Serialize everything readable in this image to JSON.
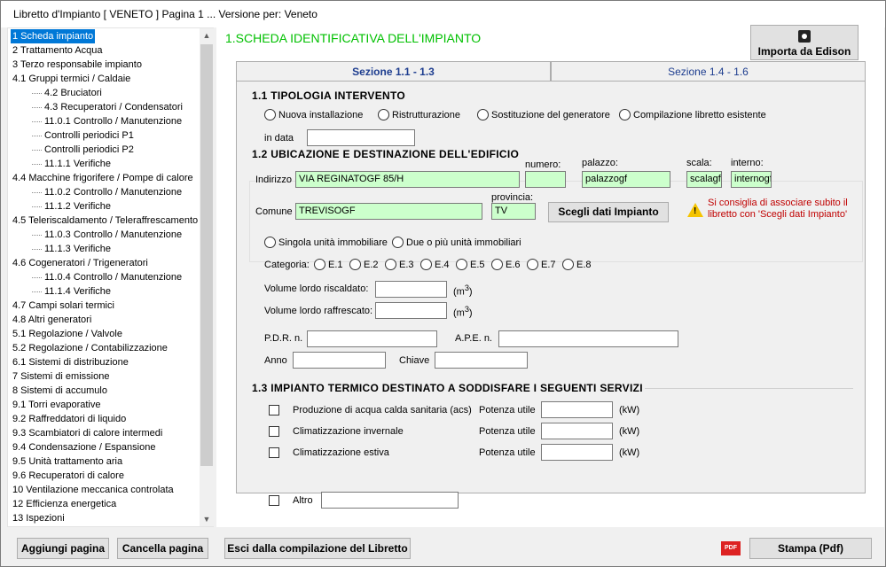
{
  "titlebar": {
    "text": "Libretto d'Impianto  [  VENETO  ]  Pagina 1 ... Versione per: Veneto"
  },
  "sidebar": {
    "items": [
      {
        "label": "1  Scheda impianto",
        "indent": 0,
        "selected": true
      },
      {
        "label": "2  Trattamento Acqua",
        "indent": 0
      },
      {
        "label": "3  Terzo responsabile impianto",
        "indent": 0
      },
      {
        "label": "4.1  Gruppi termici / Caldaie",
        "indent": 0
      },
      {
        "label": "4.2  Bruciatori",
        "indent": 2
      },
      {
        "label": "4.3  Recuperatori / Condensatori",
        "indent": 2
      },
      {
        "label": "11.0.1  Controllo / Manutenzione",
        "indent": 2
      },
      {
        "label": "Controlli periodici P1",
        "indent": 2
      },
      {
        "label": "Controlli periodici P2",
        "indent": 2
      },
      {
        "label": "11.1.1  Verifiche",
        "indent": 2
      },
      {
        "label": "4.4  Macchine frigorifere / Pompe di calore",
        "indent": 0
      },
      {
        "label": "11.0.2  Controllo / Manutenzione",
        "indent": 2
      },
      {
        "label": "11.1.2  Verifiche",
        "indent": 2
      },
      {
        "label": "4.5  Teleriscaldamento / Teleraffrescamento",
        "indent": 0
      },
      {
        "label": "11.0.3  Controllo / Manutenzione",
        "indent": 2
      },
      {
        "label": "11.1.3  Verifiche",
        "indent": 2
      },
      {
        "label": "4.6  Cogeneratori / Trigeneratori",
        "indent": 0
      },
      {
        "label": "11.0.4  Controllo / Manutenzione",
        "indent": 2
      },
      {
        "label": "11.1.4  Verifiche",
        "indent": 2
      },
      {
        "label": "4.7  Campi solari termici",
        "indent": 0
      },
      {
        "label": "4.8  Altri generatori",
        "indent": 0
      },
      {
        "label": "5.1  Regolazione / Valvole",
        "indent": 0
      },
      {
        "label": "5.2  Regolazione / Contabilizzazione",
        "indent": 0
      },
      {
        "label": "6.1  Sistemi di distribuzione",
        "indent": 0
      },
      {
        "label": "7  Sistemi di emissione",
        "indent": 0
      },
      {
        "label": "8  Sistemi di accumulo",
        "indent": 0
      },
      {
        "label": "9.1  Torri evaporative",
        "indent": 0
      },
      {
        "label": "9.2  Raffreddatori di liquido",
        "indent": 0
      },
      {
        "label": "9.3  Scambiatori di calore intermedi",
        "indent": 0
      },
      {
        "label": "9.4  Condensazione / Espansione",
        "indent": 0
      },
      {
        "label": "9.5  Unità trattamento aria",
        "indent": 0
      },
      {
        "label": "9.6  Recuperatori di calore",
        "indent": 0
      },
      {
        "label": "10  Ventilazione meccanica controlata",
        "indent": 0
      },
      {
        "label": "12  Efficienza energetica",
        "indent": 0
      },
      {
        "label": "13  Ispezioni",
        "indent": 0
      }
    ]
  },
  "main": {
    "heading": "1.SCHEDA IDENTIFICATIVA DELL'IMPIANTO",
    "import_button": "Importa da Edison",
    "tabs": [
      "Sezione  1.1  -  1.3",
      "Sezione  1.4  -  1.6"
    ],
    "s11": {
      "title": "1.1 TIPOLOGIA INTERVENTO",
      "options": [
        "Nuova installazione",
        "Ristrutturazione",
        "Sostituzione del generatore",
        "Compilazione libretto esistente"
      ],
      "in_data_label": "in data",
      "in_data_value": ""
    },
    "s12": {
      "title": "1.2 UBICAZIONE E DESTINAZIONE DELL'EDIFICIO",
      "indirizzo_label": "Indirizzo",
      "indirizzo_value": "VIA REGINATOGF 85/H",
      "numero_label": "numero:",
      "numero_value": "",
      "palazzo_label": "palazzo:",
      "palazzo_value": "palazzogf",
      "scala_label": "scala:",
      "scala_value": "scalagf",
      "interno_label": "interno:",
      "interno_value": "internogf",
      "comune_label": "Comune",
      "comune_value": "TREVISOGF",
      "provincia_label": "provincia:",
      "provincia_value": "TV",
      "scegli_button": "Scegli dati Impianto",
      "warning": "Si consiglia di associare subito il libretto con 'Scegli dati Impianto'",
      "warning_line1": "Si consiglia di associare subito il",
      "warning_line2": "libretto con 'Scegli dati Impianto'",
      "unit_options": [
        "Singola unità immobiliare",
        "Due o più unità immobiliari"
      ],
      "categoria_label": "Categoria:",
      "categorie": [
        "E.1",
        "E.2",
        "E.3",
        "E.4",
        "E.5",
        "E.6",
        "E.7",
        "E.8"
      ],
      "vol_risc_label": "Volume lordo riscaldato:",
      "vol_raff_label": "Volume lordo raffrescato:",
      "unit_m3": "(m",
      "unit_sup": "3",
      "unit_close": ")",
      "pdr_label": "P.D.R. n.",
      "ape_label": "A.P.E. n.",
      "anno_label": "Anno",
      "chiave_label": "Chiave"
    },
    "s13": {
      "title": "1.3 IMPIANTO TERMICO DESTINATO A SODDISFARE I SEGUENTI SERVIZI",
      "services": [
        "Produzione di acqua calda sanitaria (acs)",
        "Climatizzazione invernale",
        "Climatizzazione estiva"
      ],
      "potenza_label": "Potenza utile",
      "kw_label": "(kW)",
      "altro_label": "Altro"
    }
  },
  "footer": {
    "aggiungi": "Aggiungi pagina",
    "cancella": "Cancella pagina",
    "esci": "Esci dalla compilazione del Libretto",
    "pdf_icon_text": "PDF",
    "stampa": "Stampa (Pdf)"
  },
  "colors": {
    "accent_green": "#00c000",
    "field_green": "#ccffcc",
    "selection": "#0078d7",
    "warning_text": "#c00000"
  }
}
